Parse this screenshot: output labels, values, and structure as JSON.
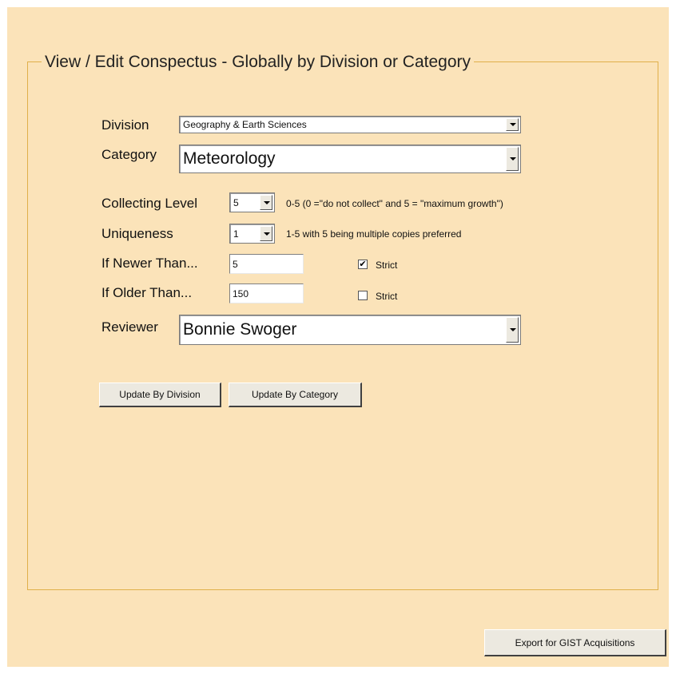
{
  "group_title": "View / Edit Conspectus - Globally by Division or Category",
  "division": {
    "label": "Division",
    "value": "Geography & Earth Sciences"
  },
  "category": {
    "label": "Category",
    "value": "Meteorology"
  },
  "collecting_level": {
    "label": "Collecting Level",
    "value": "5",
    "hint": "0-5  (0 =\"do not collect\" and 5 = \"maximum growth\")"
  },
  "uniqueness": {
    "label": "Uniqueness",
    "value": "1",
    "hint": "1-5 with 5 being multiple copies preferred"
  },
  "if_newer": {
    "label": "If Newer Than...",
    "value": "5",
    "strict_label": "Strict",
    "strict_checked": true,
    "check_glyph": "✔"
  },
  "if_older": {
    "label": "If Older Than...",
    "value": "150",
    "strict_label": "Strict",
    "strict_checked": false
  },
  "reviewer": {
    "label": "Reviewer",
    "value": "Bonnie Swoger"
  },
  "buttons": {
    "update_division": "Update By Division",
    "update_category": "Update By Category",
    "export": "Export for GIST Acquisitions"
  }
}
